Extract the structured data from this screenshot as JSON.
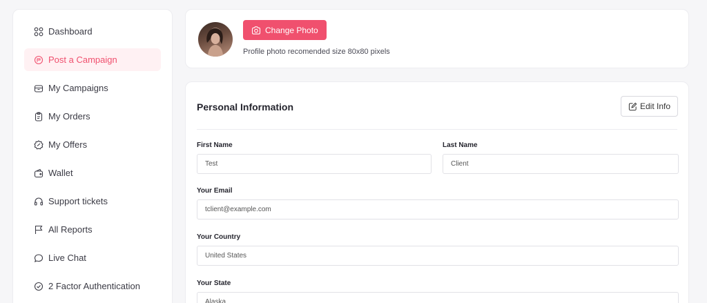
{
  "sidebar": {
    "items": [
      {
        "label": "Dashboard",
        "icon": "grid-icon"
      },
      {
        "label": "Post a Campaign",
        "icon": "campaign-icon",
        "active": true
      },
      {
        "label": "My Campaigns",
        "icon": "box-icon"
      },
      {
        "label": "My Orders",
        "icon": "clipboard-icon"
      },
      {
        "label": "My Offers",
        "icon": "badge-icon"
      },
      {
        "label": "Wallet",
        "icon": "wallet-icon"
      },
      {
        "label": "Support tickets",
        "icon": "headset-icon"
      },
      {
        "label": "All Reports",
        "icon": "flag-icon"
      },
      {
        "label": "Live Chat",
        "icon": "chat-icon"
      },
      {
        "label": "2 Factor Authentication",
        "icon": "shield-check-icon"
      }
    ]
  },
  "profile": {
    "change_photo_label": "Change Photo",
    "photo_hint": "Profile photo recomended size 80x80 pixels"
  },
  "personal": {
    "title": "Personal Information",
    "edit_label": "Edit Info",
    "first_name_label": "First Name",
    "first_name_value": "Test",
    "last_name_label": "Last Name",
    "last_name_value": "Client",
    "email_label": "Your Email",
    "email_value": "tclient@example.com",
    "country_label": "Your Country",
    "country_value": "United States",
    "state_label": "Your State",
    "state_value": "Alaska"
  },
  "colors": {
    "accent": "#f0506e",
    "active_bg": "#fff1f3"
  }
}
